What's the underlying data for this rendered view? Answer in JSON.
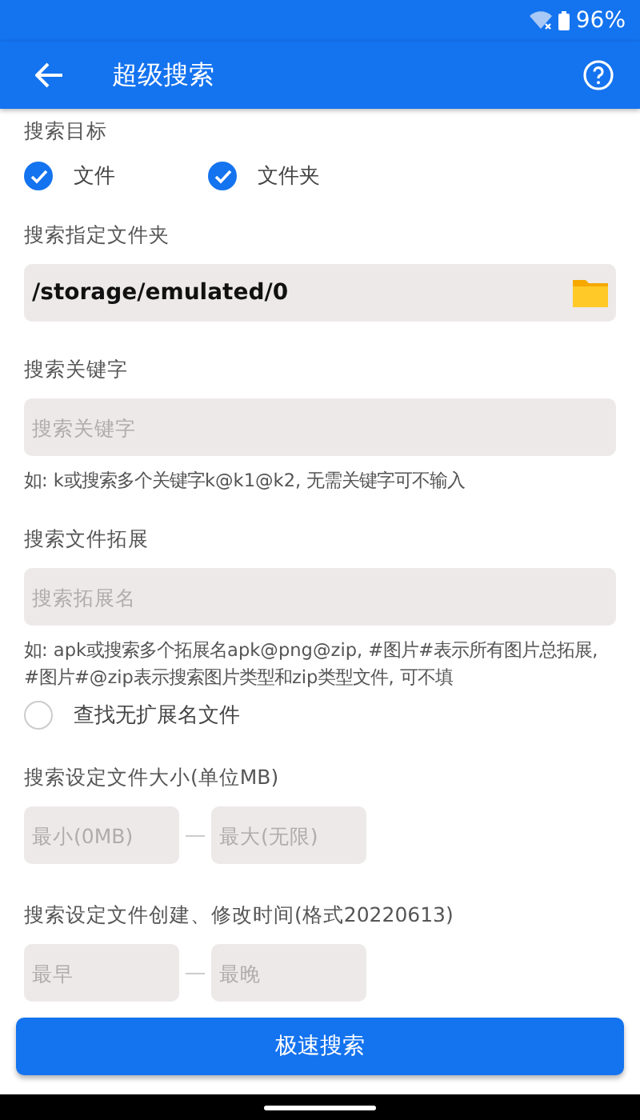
{
  "status_bar": {
    "battery": "96%"
  },
  "app_bar": {
    "title": "超级搜索"
  },
  "search_target": {
    "label": "搜索目标",
    "options": [
      {
        "label": "文件",
        "checked": true
      },
      {
        "label": "文件夹",
        "checked": true
      }
    ]
  },
  "folder": {
    "label": "搜索指定文件夹",
    "value": "/storage/emulated/0"
  },
  "keyword": {
    "label": "搜索关键字",
    "placeholder": "搜索关键字",
    "hint": "如: k或搜索多个关键字k@k1@k2, 无需关键字可不输入"
  },
  "extension": {
    "label": "搜索文件拓展",
    "placeholder": "搜索拓展名",
    "hint": "如: apk或搜索多个拓展名apk@png@zip, #图片#表示所有图片总拓展, #图片#@zip表示搜索图片类型和zip类型文件, 可不填",
    "no_extension": {
      "label": "查找无扩展名文件",
      "checked": false
    }
  },
  "size": {
    "label": "搜索设定文件大小(单位MB)",
    "min_placeholder": "最小(0MB)",
    "max_placeholder": "最大(无限)"
  },
  "time": {
    "label": "搜索设定文件创建、修改时间(格式20220613)",
    "min_placeholder": "最早",
    "max_placeholder": "最晚"
  },
  "search_button": "极速搜索"
}
